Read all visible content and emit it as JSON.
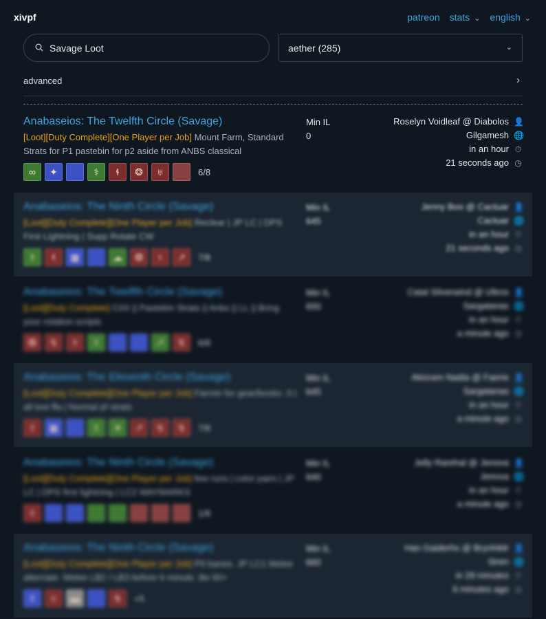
{
  "header": {
    "brand": "xivpf",
    "nav": [
      {
        "label": "patreon",
        "dropdown": false
      },
      {
        "label": "stats",
        "dropdown": true
      },
      {
        "label": "english",
        "dropdown": true
      }
    ]
  },
  "search": {
    "value": "Savage Loot",
    "icon": "search-icon"
  },
  "datacenter_select": {
    "value": "aether (285)"
  },
  "advanced": {
    "label": "advanced"
  },
  "listings": [
    {
      "duty": "Anabaseios: The Twelfth Circle (Savage)",
      "tags": "[Loot][Duty Complete][One Player per Job]",
      "description": " Mount Farm, Standard Strats for P1 pastebin for p2 aside from ANBS classical",
      "il_label": "Min IL",
      "il_value": "0",
      "creator": "Roselyn Voidleaf @ Diabolos",
      "world": "Gilgamesh",
      "expires": "in an hour",
      "updated": "21 seconds ago",
      "slots": [
        {
          "role": "heal",
          "glyph": "∞"
        },
        {
          "role": "tank",
          "glyph": "✦"
        },
        {
          "role": "tank",
          "glyph": ""
        },
        {
          "role": "heal",
          "glyph": "⚕"
        },
        {
          "role": "dps",
          "glyph": "ɬ"
        },
        {
          "role": "dps",
          "glyph": "❂"
        },
        {
          "role": "dps",
          "glyph": "♅"
        },
        {
          "role": "empty",
          "glyph": ""
        }
      ],
      "count": "6/8"
    },
    {
      "duty": "Anabaseios: The Ninth Circle (Savage)",
      "tags": "[Loot][Duty Complete][One Player per Job]",
      "description": " Reclear | JP LC | DPS First Lightning | Supp Rotate CW",
      "il_label": "Min IL",
      "il_value": "645",
      "creator": "Jenny Boo @ Cactuar",
      "world": "Cactuar",
      "expires": "in an hour",
      "updated": "21 seconds ago",
      "slots": [
        {
          "role": "heal",
          "glyph": "⚕"
        },
        {
          "role": "dps",
          "glyph": "ɬ"
        },
        {
          "role": "tank",
          "glyph": "▦"
        },
        {
          "role": "tank",
          "glyph": ""
        },
        {
          "role": "heal",
          "glyph": "☁"
        },
        {
          "role": "dps",
          "glyph": "❂"
        },
        {
          "role": "dps",
          "glyph": "♆"
        },
        {
          "role": "dps",
          "glyph": "↗"
        }
      ],
      "count": "7/8"
    },
    {
      "duty": "Anabaseios: The Twelfth Circle (Savage)",
      "tags": "[Loot][Duty Complete]",
      "description": " C4X || Pastebin Strats || Anbs || LL || Bring your rotation scripts",
      "il_label": "Min IL",
      "il_value": "650",
      "creator": "Catal Silverwind @ Ultros",
      "world": "Sargatanas",
      "expires": "in an hour",
      "updated": "a minute ago",
      "slots": [
        {
          "role": "dps",
          "glyph": "❂"
        },
        {
          "role": "dps",
          "glyph": "↯"
        },
        {
          "role": "dps",
          "glyph": "ɬ"
        },
        {
          "role": "heal",
          "glyph": "⚕"
        },
        {
          "role": "tank",
          "glyph": ""
        },
        {
          "role": "tank",
          "glyph": ""
        },
        {
          "role": "heal",
          "glyph": "↗"
        },
        {
          "role": "dps",
          "glyph": "↯"
        }
      ],
      "count": "6/8"
    },
    {
      "duty": "Anabaseios: The Eleventh Circle (Savage)",
      "tags": "[Loot][Duty Complete][One Player per Job]",
      "description": " Farmin for gear/books :3 | all loot ffa | Normal pf strats",
      "il_label": "Min IL",
      "il_value": "645",
      "creator": "Akisram Nadia @ Faerie",
      "world": "Sargatanas",
      "expires": "in an hour",
      "updated": "a minute ago",
      "slots": [
        {
          "role": "dps",
          "glyph": "ɬ"
        },
        {
          "role": "tank",
          "glyph": "▦"
        },
        {
          "role": "tank",
          "glyph": ""
        },
        {
          "role": "heal",
          "glyph": "⚕"
        },
        {
          "role": "heal",
          "glyph": "☀"
        },
        {
          "role": "dps",
          "glyph": "↗"
        },
        {
          "role": "dps",
          "glyph": "↯"
        },
        {
          "role": "dps",
          "glyph": "↯"
        }
      ],
      "count": "7/8"
    },
    {
      "duty": "Anabaseios: The Ninth Circle (Savage)",
      "tags": "[Loot][Duty Complete][One Player per Job]",
      "description": " few runs | color pairs | JP LC | DPS first lightning | LC2 WAYMARKS",
      "il_label": "Min IL",
      "il_value": "640",
      "creator": "Jelly Rarehal @ Jenova",
      "world": "Jenova",
      "expires": "in an hour",
      "updated": "a minute ago",
      "slots": [
        {
          "role": "dps",
          "glyph": "ɬ"
        },
        {
          "role": "tank",
          "glyph": ""
        },
        {
          "role": "tank",
          "glyph": ""
        },
        {
          "role": "heal",
          "glyph": ""
        },
        {
          "role": "heal",
          "glyph": ""
        },
        {
          "role": "empty",
          "glyph": ""
        },
        {
          "role": "empty",
          "glyph": ""
        },
        {
          "role": "empty",
          "glyph": ""
        }
      ],
      "count": "1/8"
    },
    {
      "duty": "Anabaseios: The Ninth Circle (Savage)",
      "tags": "[Loot][Duty Complete][One Player per Job]",
      "description": " P9 banes. JP LC1 Melee alternate. Melee LB2 / LB3 before 6 minute. Be 90+",
      "il_label": "Min IL",
      "il_value": "660",
      "creator": "Han Gaiderhs @ Brynhildr",
      "world": "Siren",
      "expires": "in 29 minutes",
      "updated": "6 minutes ago",
      "slots": [
        {
          "role": "tank",
          "glyph": "♗"
        },
        {
          "role": "dps",
          "glyph": "♅"
        },
        {
          "role": "gray",
          "glyph": "▬"
        },
        {
          "role": "tank",
          "glyph": ""
        },
        {
          "role": "dps",
          "glyph": "↯"
        }
      ],
      "count": "+5"
    }
  ]
}
